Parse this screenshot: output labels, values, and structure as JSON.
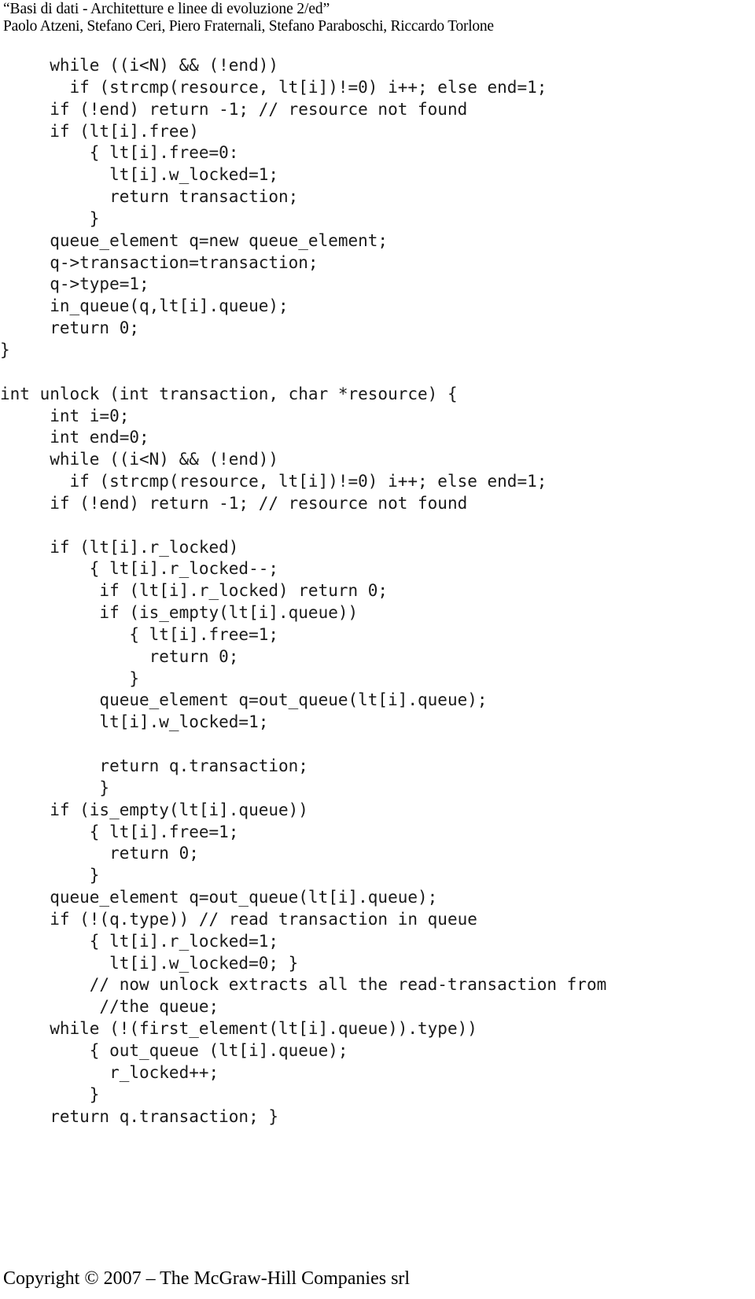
{
  "header": {
    "title": "“Basi di dati - Architetture e linee di evoluzione 2/ed”",
    "authors": "Paolo Atzeni, Stefano Ceri, Piero Fraternali, Stefano Paraboschi, Riccardo Torlone"
  },
  "footer": {
    "copyright": "Copyright © 2007 – The McGraw-Hill Companies srl"
  },
  "code": {
    "language": "c",
    "lines": [
      "     while ((i<N) && (!end))",
      "       if (strcmp(resource, lt[i])!=0) i++; else end=1;",
      "     if (!end) return -1; // resource not found",
      "     if (lt[i].free)",
      "         { lt[i].free=0:",
      "           lt[i].w_locked=1;",
      "           return transaction;",
      "         }",
      "     queue_element q=new queue_element;",
      "     q->transaction=transaction;",
      "     q->type=1;",
      "     in_queue(q,lt[i].queue);",
      "     return 0;",
      "}",
      "",
      "int unlock (int transaction, char *resource) {",
      "     int i=0;",
      "     int end=0;",
      "     while ((i<N) && (!end))",
      "       if (strcmp(resource, lt[i])!=0) i++; else end=1;",
      "     if (!end) return -1; // resource not found",
      "",
      "     if (lt[i].r_locked)",
      "         { lt[i].r_locked--;",
      "          if (lt[i].r_locked) return 0;",
      "          if (is_empty(lt[i].queue))",
      "             { lt[i].free=1;",
      "               return 0;",
      "             }",
      "          queue_element q=out_queue(lt[i].queue);",
      "          lt[i].w_locked=1;",
      "",
      "          return q.transaction;",
      "          }",
      "     if (is_empty(lt[i].queue))",
      "         { lt[i].free=1;",
      "           return 0;",
      "         }",
      "     queue_element q=out_queue(lt[i].queue);",
      "     if (!(q.type)) // read transaction in queue",
      "         { lt[i].r_locked=1;",
      "           lt[i].w_locked=0; }",
      "         // now unlock extracts all the read-transaction from",
      "          //the queue;",
      "     while (!(first_element(lt[i].queue)).type))",
      "         { out_queue (lt[i].queue);",
      "           r_locked++;",
      "         }",
      "     return q.transaction; }"
    ]
  }
}
